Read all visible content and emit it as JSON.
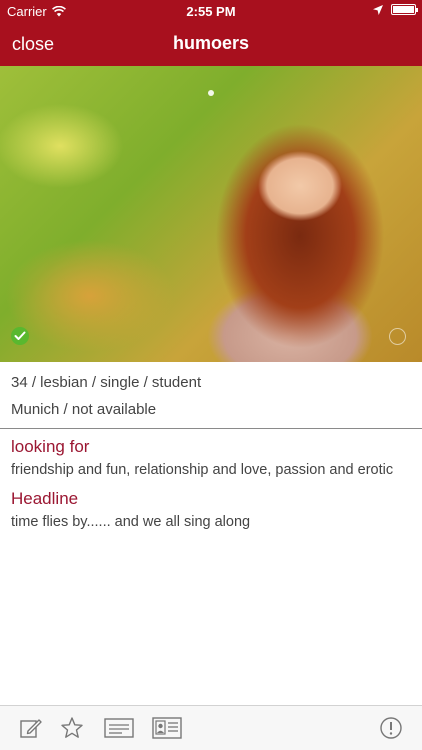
{
  "status_bar": {
    "carrier": "Carrier",
    "time": "2:55 PM"
  },
  "nav": {
    "close_label": "close",
    "title": "humoers",
    "bar_color": "#a8101e"
  },
  "photo": {
    "verified_icon": "check-circle-icon",
    "next_icon": "arrow-circle-icon"
  },
  "profile": {
    "summary": "34 / lesbian / single / student",
    "location": "Munich / not available"
  },
  "sections": [
    {
      "heading": "looking for",
      "text": "friendship and fun, relationship and love, passion and erotic"
    },
    {
      "heading": "Headline",
      "text": "time flies by...... and we all sing along"
    }
  ],
  "toolbar": {
    "items": [
      "compose-icon",
      "star-icon",
      "ticket-icon",
      "profile-card-icon",
      "alert-icon"
    ]
  },
  "colors": {
    "accent": "#9b1732",
    "verified": "#59b82f"
  }
}
